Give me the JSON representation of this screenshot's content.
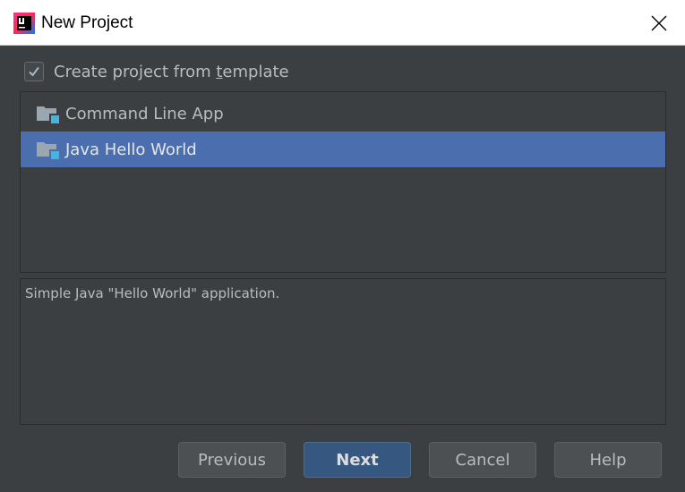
{
  "window": {
    "title": "New Project",
    "app_icon": "intellij-idea-icon",
    "close_icon": "close-icon"
  },
  "template_option": {
    "label_pre": "Create project from ",
    "label_mnemonic": "t",
    "label_post": "emplate",
    "checked": true
  },
  "templates": {
    "items": [
      {
        "label": "Command Line App",
        "icon": "folder-icon",
        "selected": false
      },
      {
        "label": "Java Hello World",
        "icon": "folder-icon",
        "selected": true
      }
    ]
  },
  "description": {
    "text": "Simple Java \"Hello World\" application."
  },
  "buttons": {
    "previous": "Previous",
    "next": "Next",
    "cancel": "Cancel",
    "help": "Help"
  },
  "colors": {
    "background": "#3c3f41",
    "selection": "#4b6eaf",
    "primary_button": "#365880"
  }
}
